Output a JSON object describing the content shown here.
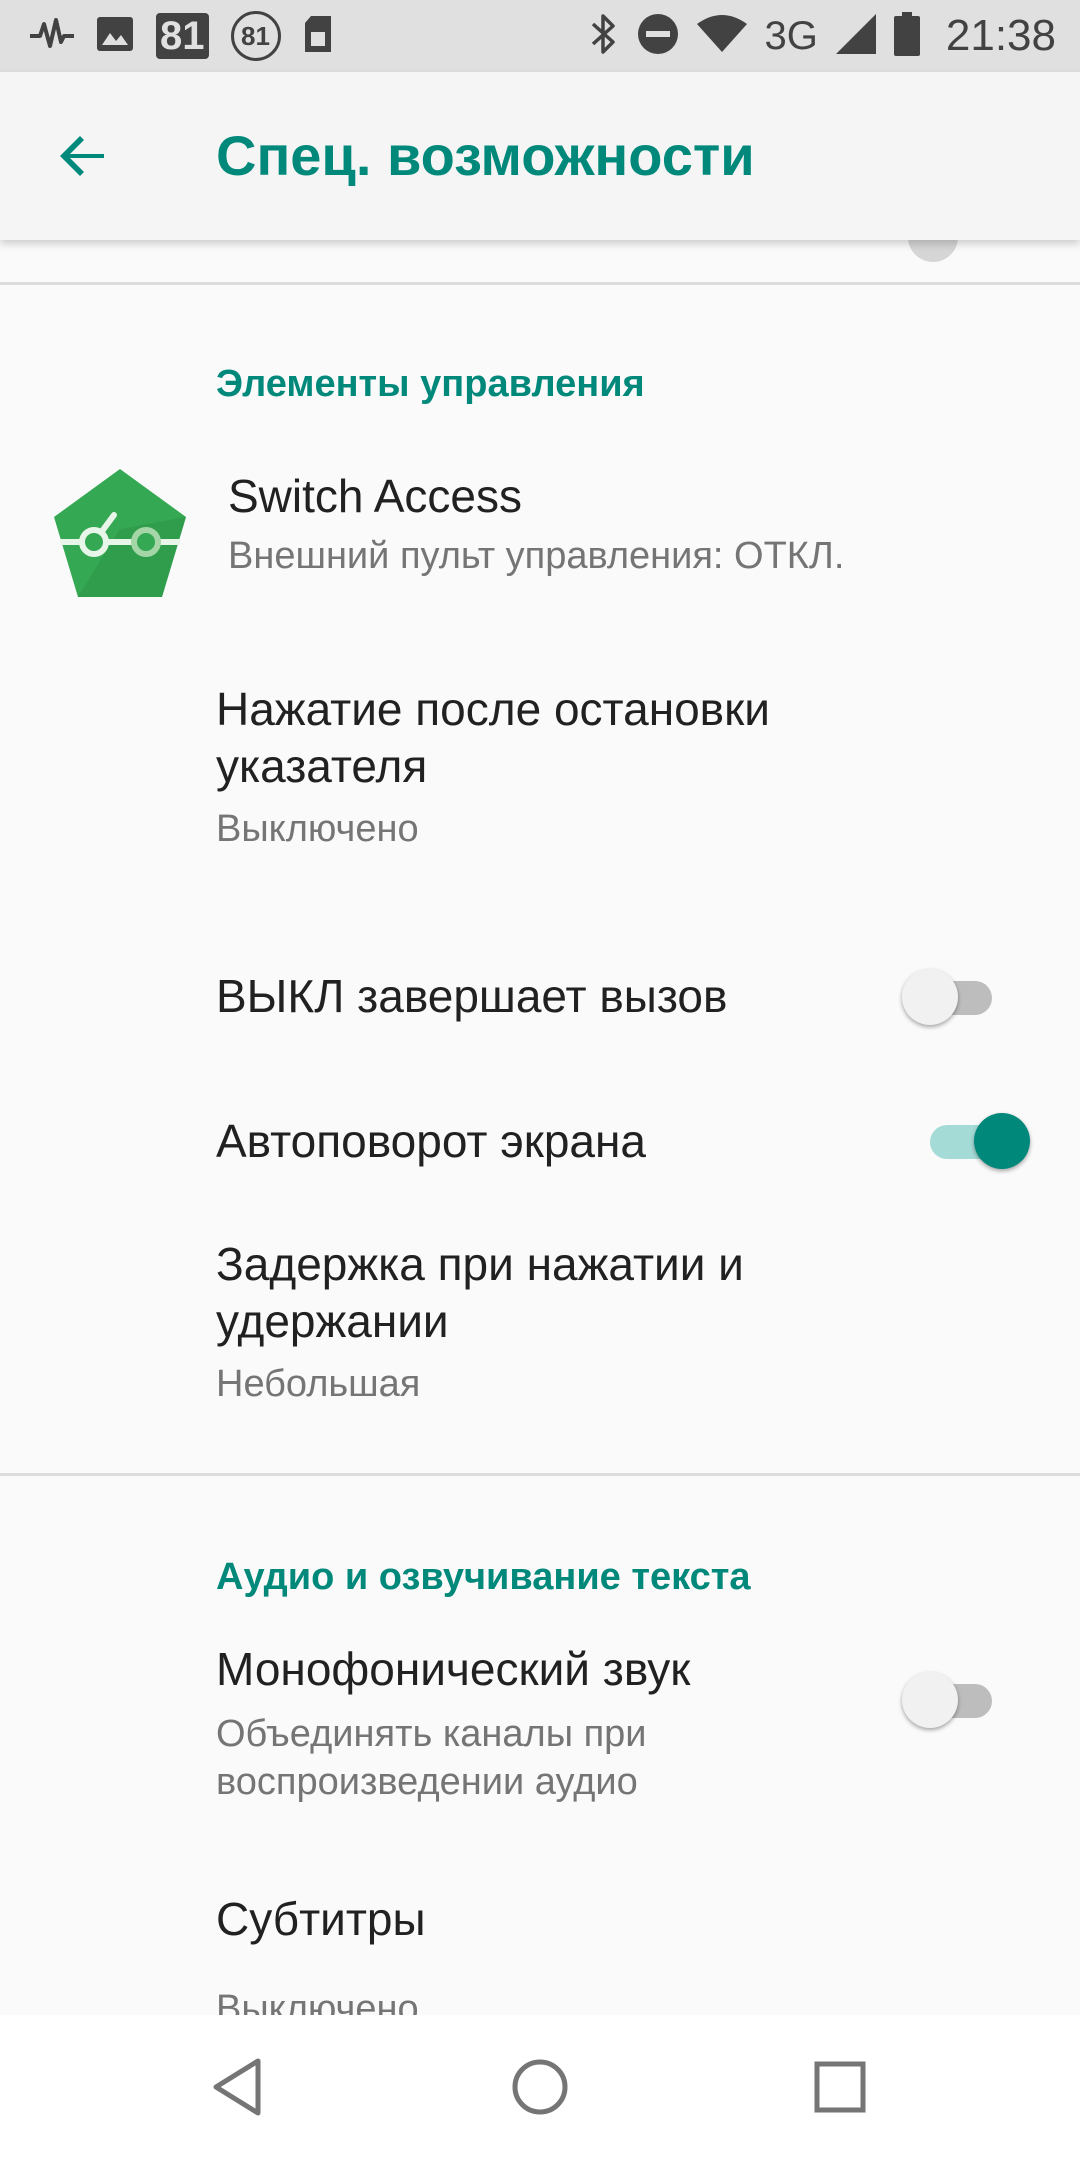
{
  "status_bar": {
    "notif_badge_text": "81",
    "notif_circle_text": "81",
    "network_type": "3G",
    "time": "21:38",
    "icons": [
      "pulse-icon",
      "image-icon",
      "badge-81-icon",
      "circle-81-icon",
      "sim-icon",
      "bluetooth-icon",
      "dnd-icon",
      "wifi-icon",
      "cellular-signal-icon",
      "battery-icon"
    ]
  },
  "app_bar": {
    "title": "Спец. возможности",
    "back_icon": "arrow-back-icon"
  },
  "sections": {
    "controls": {
      "header": "Элементы управления",
      "switch_access": {
        "title": "Switch Access",
        "subtitle": "Внешний пульт управления: ОТКЛ.",
        "icon": "switch-access-app-icon"
      },
      "dwell_click": {
        "title_line1": "Нажатие после остановки",
        "title_line2": "указателя",
        "subtitle": "Выключено"
      },
      "power_ends_call": {
        "title": "ВЫКЛ завершает вызов",
        "toggle_on": false
      },
      "auto_rotate": {
        "title": "Автоповорот экрана",
        "toggle_on": true
      },
      "touch_hold_delay": {
        "title_line1": "Задержка при нажатии и",
        "title_line2": "удержании",
        "subtitle": "Небольшая"
      }
    },
    "audio": {
      "header": "Аудио и озвучивание текста",
      "mono_audio": {
        "title": "Монофонический звук",
        "subtitle_line1": "Объединять каналы при",
        "subtitle_line2": "воспроизведении аудио",
        "toggle_on": false
      },
      "captions": {
        "title": "Субтитры",
        "subtitle": "Выключено"
      }
    }
  },
  "nav_bar": {
    "icons": [
      "nav-back-icon",
      "nav-home-icon",
      "nav-recents-icon"
    ]
  },
  "colors": {
    "accent": "#00897b",
    "switch_track_on": "#a5dbd6",
    "switch_track_off": "#bdbdbd",
    "status_bar_bg": "#e0e0e0",
    "app_bar_bg": "#f5f5f5",
    "page_bg": "#fafafa",
    "switch_access_icon": "#34a853"
  }
}
